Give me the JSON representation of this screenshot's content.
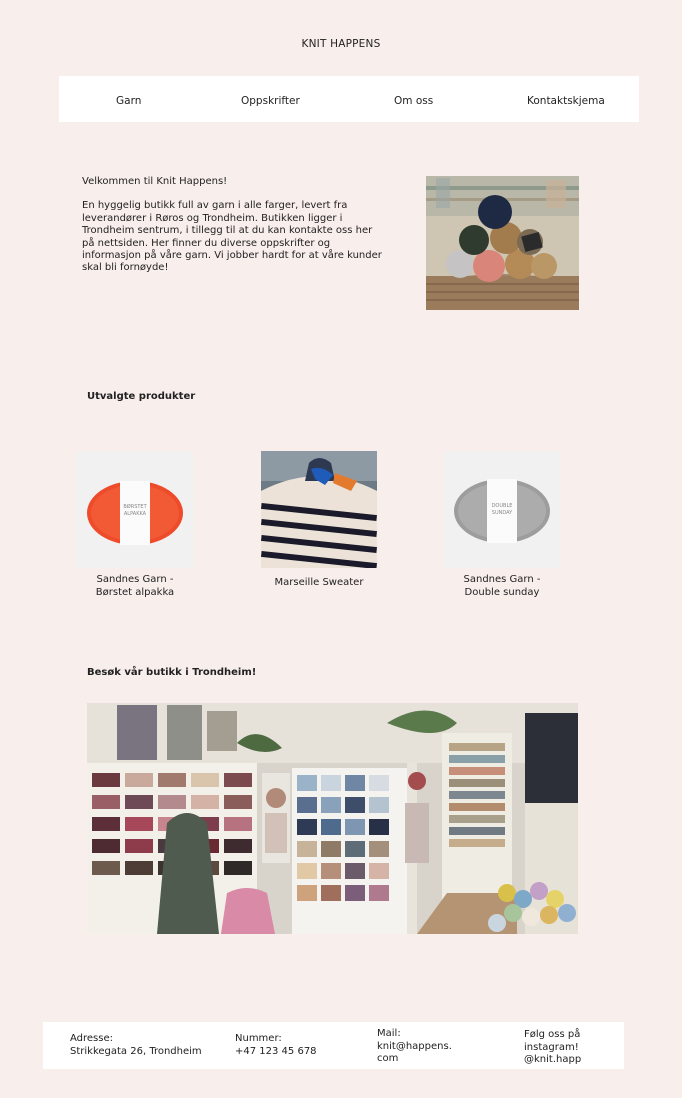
{
  "header": {
    "title": "KNIT HAPPENS"
  },
  "nav": {
    "items": [
      {
        "label": "Garn"
      },
      {
        "label": "Oppskrifter"
      },
      {
        "label": "Om oss"
      },
      {
        "label": "Kontaktskjema"
      }
    ]
  },
  "welcome": {
    "title": "Velkommen til Knit Happens!",
    "body": "En hyggelig butikk full av garn i alle farger, levert fra leverandører i Røros og Trondheim. Butikken ligger i Trondheim sentrum, i tillegg til at du kan kontakte oss her på nettsiden. Her finner du diverse oppskrifter og informasjon på våre garn. Vi jobber hardt for at våre kunder skal bli fornøyde!"
  },
  "products": {
    "heading": "Utvalgte produkter",
    "items": [
      {
        "name_line1": "Sandnes Garn -",
        "name_line2": "Børstet alpakka",
        "label_text_1": "BØRSTET",
        "label_text_2": "ALPAKKA",
        "color": "#f0502e"
      },
      {
        "name_line1": "Marseille Sweater",
        "name_line2": ""
      },
      {
        "name_line1": "Sandnes Garn -",
        "name_line2": "Double sunday",
        "label_text_1": "DOUBLE",
        "label_text_2": "SUNDAY",
        "color": "#a9a9a9"
      }
    ]
  },
  "store": {
    "heading": "Besøk vår butikk i Trondheim!"
  },
  "footer": {
    "address_label": "Adresse:",
    "address_value": "Strikkegata 26, Trondheim",
    "phone_label": "Nummer:",
    "phone_value": "+47 123 45 678",
    "mail_label": "Mail:",
    "mail_line1": "knit@happens.",
    "mail_line2": "com",
    "insta_line1": "Følg oss på",
    "insta_line2": "instagram!",
    "insta_line3": "@knit.happ"
  },
  "colors": {
    "background": "#f8eeec",
    "panel": "#ffffff",
    "text": "#222222"
  }
}
